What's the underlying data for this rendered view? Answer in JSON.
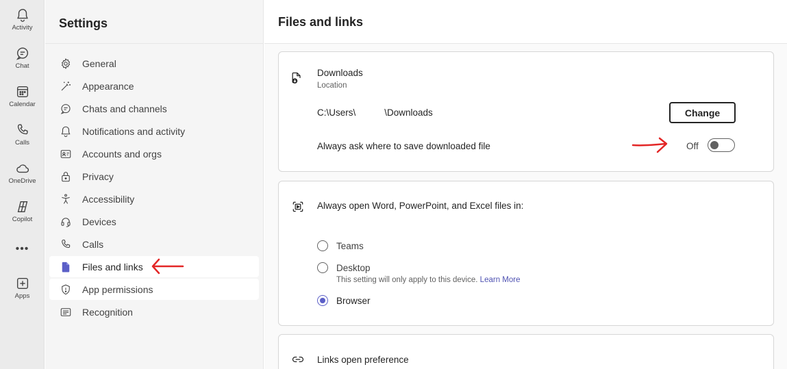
{
  "rail": {
    "items": [
      {
        "label": "Activity",
        "icon": "bell-icon"
      },
      {
        "label": "Chat",
        "icon": "chat-icon"
      },
      {
        "label": "Calendar",
        "icon": "calendar-icon"
      },
      {
        "label": "Calls",
        "icon": "phone-icon"
      },
      {
        "label": "OneDrive",
        "icon": "cloud-icon"
      },
      {
        "label": "Copilot",
        "icon": "copilot-icon"
      },
      {
        "label": "Apps",
        "icon": "add-apps-icon"
      }
    ],
    "more": "•••"
  },
  "settings": {
    "title": "Settings",
    "nav": [
      {
        "label": "General",
        "icon": "gear-icon"
      },
      {
        "label": "Appearance",
        "icon": "magic-wand-icon"
      },
      {
        "label": "Chats and channels",
        "icon": "chat-icon"
      },
      {
        "label": "Notifications and activity",
        "icon": "bell-icon"
      },
      {
        "label": "Accounts and orgs",
        "icon": "contact-card-icon"
      },
      {
        "label": "Privacy",
        "icon": "lock-icon"
      },
      {
        "label": "Accessibility",
        "icon": "accessibility-icon"
      },
      {
        "label": "Devices",
        "icon": "headset-icon"
      },
      {
        "label": "Calls",
        "icon": "phone-icon"
      },
      {
        "label": "Files and links",
        "icon": "document-icon",
        "active": true
      },
      {
        "label": "App permissions",
        "icon": "shield-icon"
      },
      {
        "label": "Recognition",
        "icon": "text-panel-icon"
      }
    ]
  },
  "main": {
    "title": "Files and links",
    "downloads": {
      "title": "Downloads",
      "subtitle": "Location",
      "path_prefix": "C:\\Users\\",
      "path_suffix": "\\Downloads",
      "change_label": "Change",
      "ask_label": "Always ask where to save downloaded file",
      "toggle_state": "Off"
    },
    "open_files": {
      "title": "Always open Word, PowerPoint, and Excel files in:",
      "options": [
        {
          "label": "Teams",
          "checked": false
        },
        {
          "label": "Desktop",
          "checked": false,
          "note": "This setting will only apply to this device.",
          "link": "Learn More"
        },
        {
          "label": "Browser",
          "checked": true
        }
      ]
    },
    "links": {
      "title": "Links open preference"
    }
  },
  "colors": {
    "accent": "#5b5fc7",
    "annotation": "#e32626"
  }
}
